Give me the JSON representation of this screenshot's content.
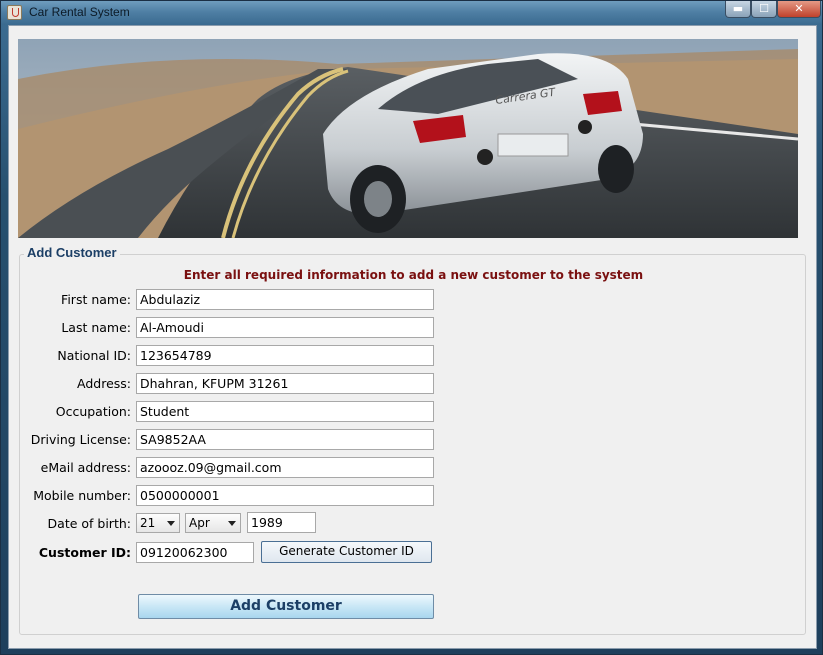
{
  "window": {
    "title": "Car Rental System",
    "min_glyph": "▬",
    "max_glyph": "☐",
    "close_glyph": "✕"
  },
  "panel": {
    "title": "Add Customer",
    "info": "Enter all required information to add a new customer to the system"
  },
  "form": {
    "first_name": {
      "label": "First name:",
      "value": "Abdulaziz"
    },
    "last_name": {
      "label": "Last name:",
      "value": "Al-Amoudi"
    },
    "national_id": {
      "label": "National ID:",
      "value": "123654789"
    },
    "address": {
      "label": "Address:",
      "value": "Dhahran, KFUPM 31261"
    },
    "occupation": {
      "label": "Occupation:",
      "value": "Student"
    },
    "driving_license": {
      "label": "Driving License:",
      "value": "SA9852AA"
    },
    "email": {
      "label": "eMail address:",
      "value": "azoooz.09@gmail.com"
    },
    "mobile": {
      "label": "Mobile number:",
      "value": "0500000001"
    },
    "dob": {
      "label": "Date of birth:",
      "day": "21",
      "month": "Apr",
      "year": "1989"
    },
    "customer_id": {
      "label": "Customer ID:",
      "value": "09120062300"
    }
  },
  "buttons": {
    "generate": "Generate Customer ID",
    "add": "Add Customer"
  },
  "colors": {
    "panel_title": "#1c3f66",
    "info_text": "#7a1010",
    "add_button": "#a9d6ee"
  },
  "banner": {
    "car_model_text": "Carrera GT"
  }
}
